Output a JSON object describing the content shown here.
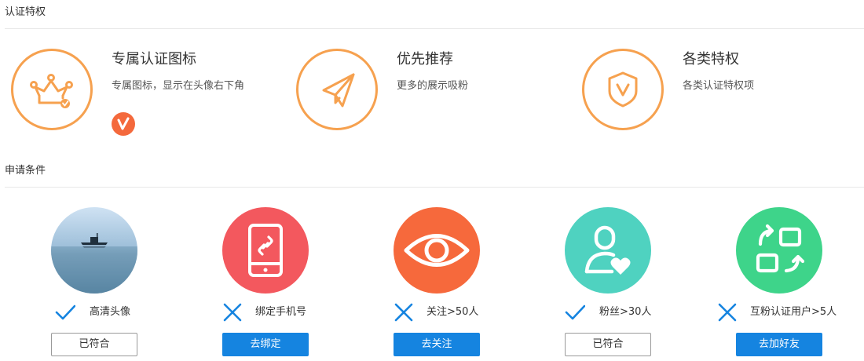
{
  "privileges": {
    "section_title": "认证特权",
    "items": [
      {
        "title": "专属认证图标",
        "desc": "专属图标，显示在头像右下角",
        "icon": "crown-icon"
      },
      {
        "title": "优先推荐",
        "desc": "更多的展示吸粉",
        "icon": "paper-plane-icon"
      },
      {
        "title": "各类特权",
        "desc": "各类认证特权项",
        "icon": "shield-icon"
      }
    ],
    "badge_icon": "verified-v-badge",
    "accent_color": "#f6a14f"
  },
  "conditions": {
    "section_title": "申请条件",
    "items": [
      {
        "label": "高清头像",
        "status": "check-icon",
        "button": "已符合",
        "button_style": "outline",
        "icon": "avatar-photo"
      },
      {
        "label": "绑定手机号",
        "status": "cross-icon",
        "button": "去绑定",
        "button_style": "primary",
        "icon": "phone-link-icon",
        "color": "#f3585e"
      },
      {
        "label": "关注>50人",
        "status": "cross-icon",
        "button": "去关注",
        "button_style": "primary",
        "icon": "eye-icon",
        "color": "#f6693c"
      },
      {
        "label": "粉丝>30人",
        "status": "check-icon",
        "button": "已符合",
        "button_style": "outline",
        "icon": "user-heart-icon",
        "color": "#4fd2c0"
      },
      {
        "label": "互粉认证用户>5人",
        "status": "cross-icon",
        "button": "去加好友",
        "button_style": "primary",
        "icon": "exchange-icon",
        "color": "#3ed48a"
      }
    ],
    "primary_button_color": "#1584e0",
    "status_color": "#1584e0"
  }
}
